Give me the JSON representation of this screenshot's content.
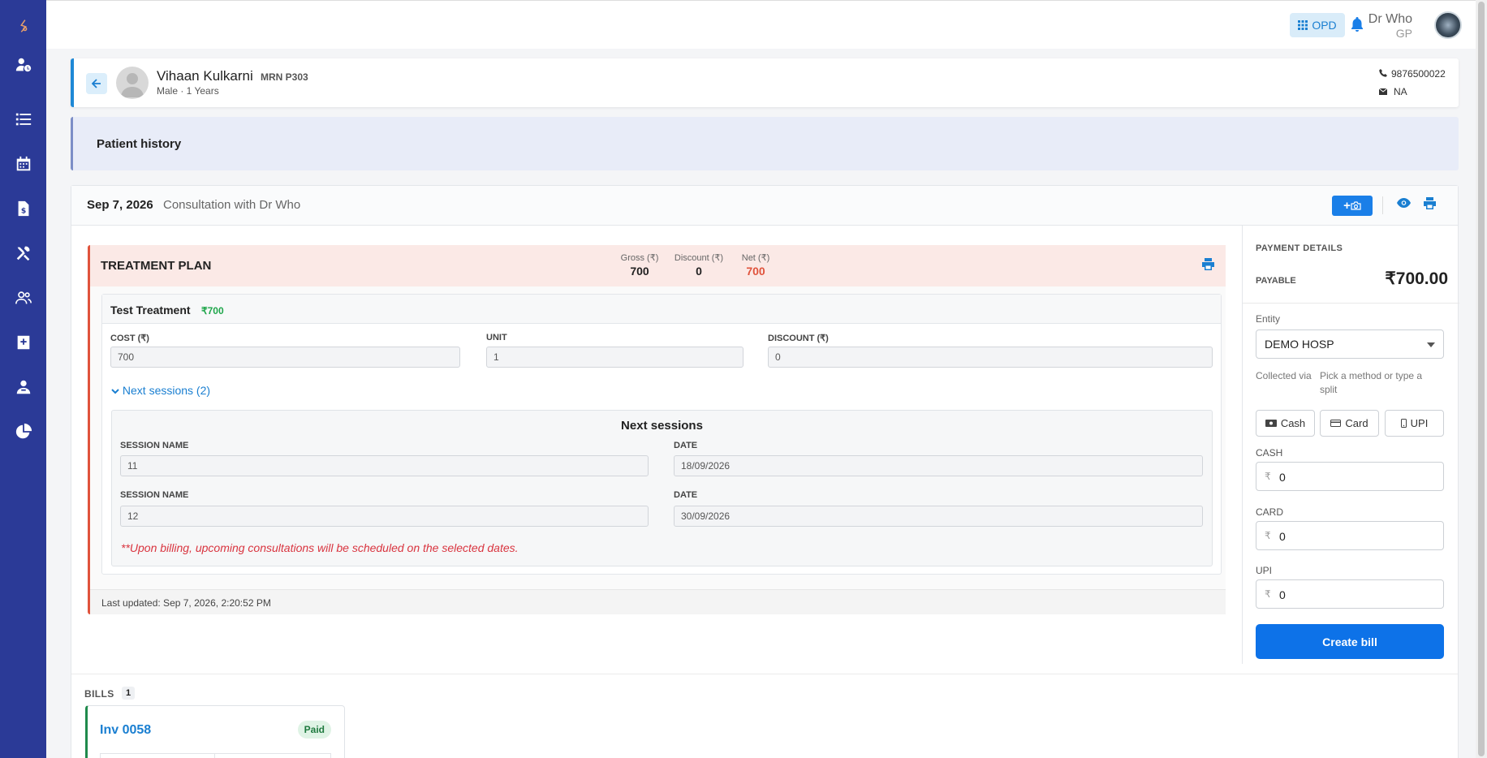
{
  "sidebar": {
    "items": [
      {
        "icon": "logo-icon"
      },
      {
        "icon": "user-clock-icon"
      },
      {
        "icon": "list-icon"
      },
      {
        "icon": "calendar-icon"
      },
      {
        "icon": "invoice-icon"
      },
      {
        "icon": "tools-icon"
      },
      {
        "icon": "users-icon"
      },
      {
        "icon": "medical-notes-icon"
      },
      {
        "icon": "doctor-icon"
      },
      {
        "icon": "pie-chart-icon"
      }
    ],
    "color": "#2b3a97"
  },
  "topbar": {
    "opd_label": "OPD",
    "user_name": "Dr Who",
    "user_role": "GP"
  },
  "patient": {
    "name": "Vihaan Kulkarni",
    "mrn": "MRN P303",
    "meta": "Male · 1 Years",
    "phone": "9876500022",
    "email": "NA"
  },
  "history": {
    "title": "Patient history"
  },
  "consultation": {
    "date": "Sep 7, 2026",
    "title": "Consultation with Dr Who"
  },
  "treatment_plan": {
    "title": "TREATMENT PLAN",
    "gross_label": "Gross (₹)",
    "gross_value": "700",
    "discount_label": "Discount (₹)",
    "discount_value": "0",
    "net_label": "Net (₹)",
    "net_value": "700",
    "treatment": {
      "name": "Test Treatment",
      "price": "₹700",
      "cost_label": "COST (₹)",
      "cost_value": "700",
      "unit_label": "UNIT",
      "unit_value": "1",
      "discount_label": "DISCOUNT (₹)",
      "discount_value": "0",
      "next_toggle": "Next sessions (2)",
      "next_sessions": {
        "title": "Next sessions",
        "session_name_label": "SESSION NAME",
        "date_label": "DATE",
        "rows": [
          {
            "name": "11",
            "date": "18/09/2026"
          },
          {
            "name": "12",
            "date": "30/09/2026"
          }
        ],
        "note": "**Upon billing, upcoming consultations will be scheduled on the selected dates."
      }
    },
    "last_updated": "Last updated: Sep 7, 2026, 2:20:52 PM"
  },
  "payment": {
    "title": "PAYMENT DETAILS",
    "payable_label": "PAYABLE",
    "payable_amount": "₹700.00",
    "entity_label": "Entity",
    "entity_value": "DEMO HOSP",
    "collected_label": "Collected via",
    "hint": "Pick a method or type a split",
    "methods": [
      "Cash",
      "Card",
      "UPI"
    ],
    "cash_label": "CASH",
    "cash_value": "0",
    "card_label": "CARD",
    "card_value": "0",
    "upi_label": "UPI",
    "upi_value": "0",
    "currency": "₹",
    "create_bill": "Create bill"
  },
  "bills": {
    "label": "BILLS",
    "count": "1",
    "items": [
      {
        "title": "Inv 0058",
        "status": "Paid"
      }
    ]
  },
  "colors": {
    "accent": "#1a7fe8",
    "danger": "#e0533c",
    "success": "#1fa64b"
  }
}
